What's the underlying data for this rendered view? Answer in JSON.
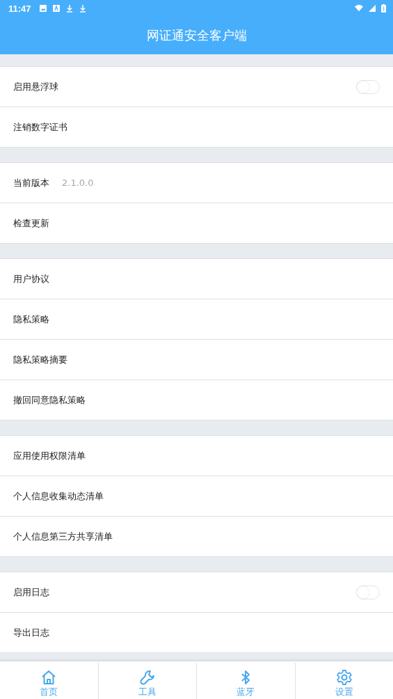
{
  "status_bar": {
    "time": "11:47"
  },
  "header": {
    "title": "网证通安全客户端"
  },
  "groups": [
    {
      "rows": [
        {
          "kind": "toggle",
          "label": "启用悬浮球",
          "on": false
        },
        {
          "kind": "link",
          "label": "注销数字证书"
        }
      ]
    },
    {
      "rows": [
        {
          "kind": "value",
          "label": "当前版本",
          "value": "2.1.0.0"
        },
        {
          "kind": "link",
          "label": "检查更新"
        }
      ]
    },
    {
      "rows": [
        {
          "kind": "link",
          "label": "用户协议"
        },
        {
          "kind": "link",
          "label": "隐私策略"
        },
        {
          "kind": "link",
          "label": "隐私策略摘要"
        },
        {
          "kind": "link",
          "label": "撤回同意隐私策略"
        }
      ]
    },
    {
      "rows": [
        {
          "kind": "link",
          "label": "应用使用权限清单"
        },
        {
          "kind": "link",
          "label": "个人信息收集动态清单"
        },
        {
          "kind": "link",
          "label": "个人信息第三方共享清单"
        }
      ]
    },
    {
      "rows": [
        {
          "kind": "toggle",
          "label": "启用日志",
          "on": false
        },
        {
          "kind": "link",
          "label": "导出日志"
        }
      ]
    }
  ],
  "bottom_nav": [
    {
      "label": "首页"
    },
    {
      "label": "工具"
    },
    {
      "label": "蓝牙"
    },
    {
      "label": "设置"
    }
  ]
}
